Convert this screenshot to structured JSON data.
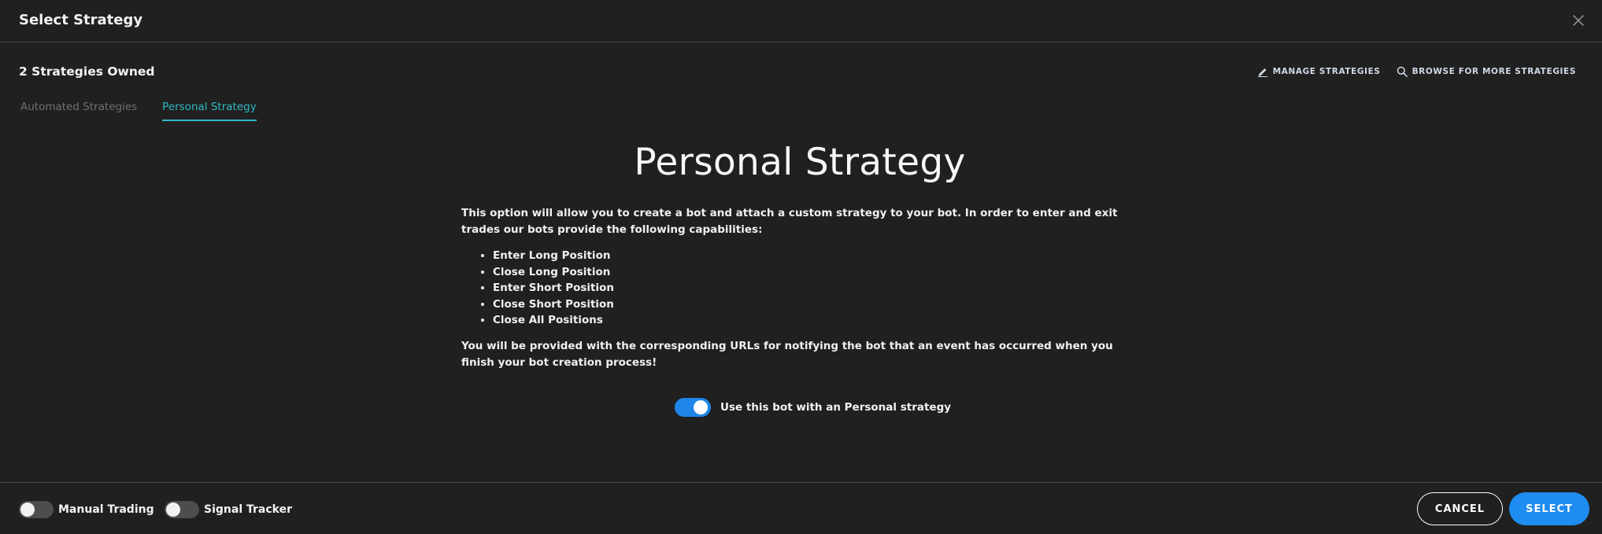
{
  "header": {
    "title": "Select Strategy",
    "close_icon": "close-icon"
  },
  "toolbar": {
    "owned_text": "2 Strategies Owned",
    "manage_label": "MANAGE STRATEGIES",
    "browse_label": "BROWSE FOR MORE STRATEGIES"
  },
  "tabs": [
    {
      "label": "Automated Strategies",
      "active": false
    },
    {
      "label": "Personal Strategy",
      "active": true
    }
  ],
  "main": {
    "heading": "Personal Strategy",
    "intro": "This option will allow you to create a bot and attach a custom strategy to your bot. In order to enter and exit trades our bots provide the following capabilities:",
    "capabilities": [
      "Enter Long Position",
      "Close Long Position",
      "Enter Short Position",
      "Close Short Position",
      "Close All Positions"
    ],
    "outro": "You will be provided with the corresponding URLs for notifying the bot that an event has occurred when you finish your bot creation process!",
    "toggle_label": "Use this bot with an Personal strategy",
    "toggle_on": true
  },
  "footer": {
    "manual_trading_label": "Manual Trading",
    "manual_trading_on": false,
    "signal_tracker_label": "Signal Tracker",
    "signal_tracker_on": false,
    "cancel_label": "CANCEL",
    "select_label": "SELECT"
  },
  "colors": {
    "accent_tab": "#2fb8c6",
    "primary_button": "#1e8cf0",
    "background": "#202020"
  }
}
